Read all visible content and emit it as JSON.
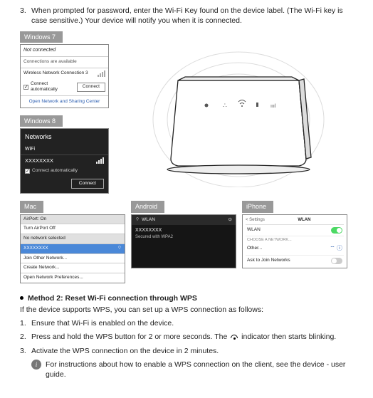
{
  "step3": {
    "num": "3.",
    "text": "When prompted for password, enter the Wi-Fi Key found on the device label. (The Wi-Fi key is case sensitive.) Your device will notify you when it is connected."
  },
  "win7": {
    "tab": "Windows 7",
    "not_connected": "Not connected",
    "avail": "Connections are available",
    "conn_name": "Wireless Network Connection 3",
    "auto": "Connect automatically",
    "connect_btn": "Connect",
    "link": "Open Network and Sharing Center"
  },
  "win8": {
    "tab": "Windows 8",
    "networks": "Networks",
    "wifi": "WiFi",
    "ssid": "XXXXXXXX",
    "auto": "Connect automatically",
    "connect_btn": "Connect"
  },
  "mac": {
    "tab": "Mac",
    "airport_on": "AirPort: On",
    "turn_off": "Turn AirPort Off",
    "no_net": "No network selected",
    "ssid": "XXXXXXXX",
    "join": "Join Other Network...",
    "create": "Create Network...",
    "prefs": "Open Network Preferences..."
  },
  "android": {
    "tab": "Android",
    "wlan": "WLAN",
    "ssid": "XXXXXXXX",
    "secured": "Secured with WPA2"
  },
  "iphone": {
    "tab": "iPhone",
    "back": "< Settings",
    "title": "WLAN",
    "wlan_label": "WLAN",
    "section": "CHOOSE A NETWORK...",
    "other": "Other...",
    "ask": "Ask to Join Networks"
  },
  "method2": {
    "title": "Method 2: Reset Wi-Fi connection through WPS",
    "intro": "If the device supports WPS, you can set up a WPS connection as follows:",
    "s1n": "1.",
    "s1": "Ensure that Wi-Fi is enabled on the device.",
    "s2n": "2.",
    "s2a": "Press and hold the WPS button for 2 or more seconds. The",
    "s2b": "indicator then starts blinking.",
    "s3n": "3.",
    "s3": "Activate the WPS connection on the device in 2 minutes.",
    "note": "For instructions about how to enable a WPS connection on the client, see the device - user guide."
  }
}
